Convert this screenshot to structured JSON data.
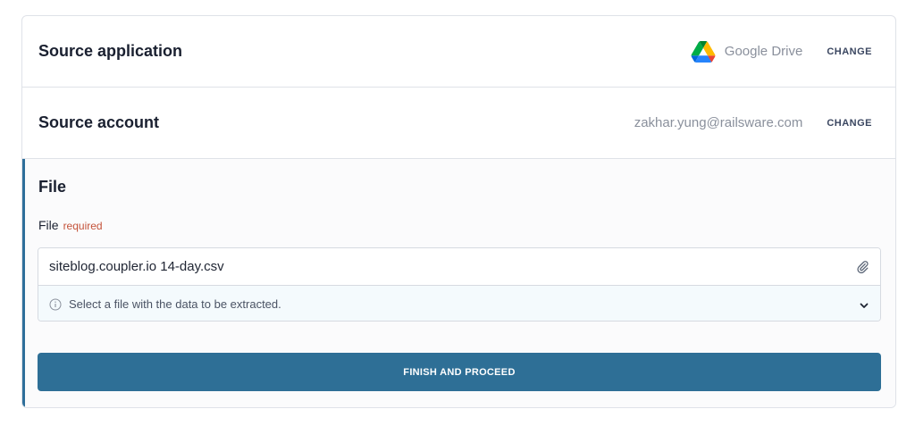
{
  "source_application": {
    "title": "Source application",
    "value": "Google Drive",
    "icon": "google-drive-icon",
    "change_label": "CHANGE"
  },
  "source_account": {
    "title": "Source account",
    "value": "zakhar.yung@railsware.com",
    "change_label": "CHANGE"
  },
  "file_section": {
    "title": "File",
    "field_label": "File",
    "required_label": "required",
    "file_value": "siteblog.coupler.io 14-day.csv",
    "hint": "Select a file with the data to be extracted.",
    "attach_icon": "paperclip-icon",
    "info_icon": "info-icon",
    "expand_icon": "chevron-down-icon"
  },
  "actions": {
    "primary_label": "FINISH AND PROCEED"
  },
  "colors": {
    "accent": "#2e6f96",
    "required": "#c4523a",
    "hint_background": "#f4fafd"
  }
}
